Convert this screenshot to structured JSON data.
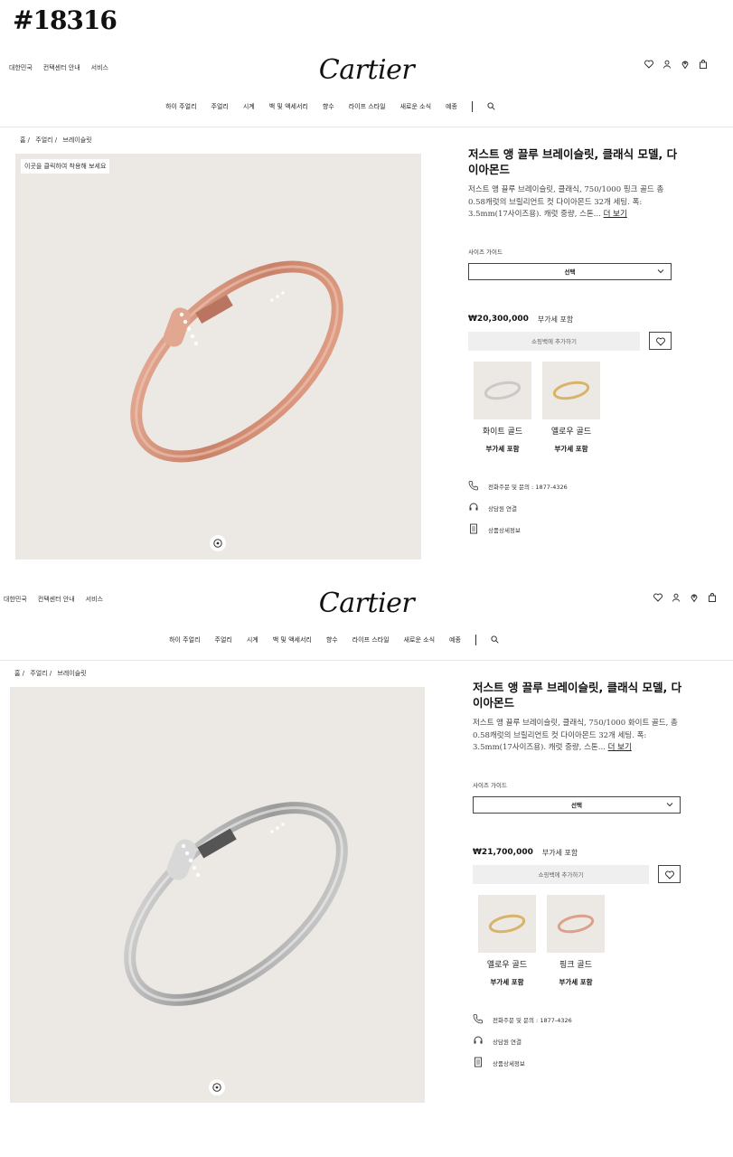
{
  "sheet_tag": "#18316",
  "header": {
    "util_links": [
      "대한민국",
      "컨택센터 안내",
      "서비스"
    ],
    "logo": "Cartier",
    "icons": [
      "heart-icon",
      "user-icon",
      "location-pin-icon",
      "shopping-bag-icon"
    ],
    "nav_items": [
      "하이 주얼리",
      "주얼리",
      "시계",
      "백 및 액세서리",
      "향수",
      "라이프 스타일",
      "새로운 소식",
      "예종"
    ]
  },
  "breadcrumb": [
    "홈 /",
    "주얼리 /",
    "브레이슬릿"
  ],
  "pages": [
    {
      "zoom_hint": "이곳을 클릭하여 착용해 보세요",
      "metal_color": "#d9a088",
      "title": "저스트 앵 끌루 브레이슬릿, 클래식 모델, 다이아몬드",
      "description": "저스트 앵 끌루 브레이슬릿, 클래식, 750/1000 핑크 골드 총 0.58캐럿의 브릴리언트 컷 다이아몬드 32개 세팅. 폭: 3.5mm(17사이즈용). 캐럿 중량, 스톤...",
      "more_link": "더 보기",
      "size_guide": "사이즈 가이드",
      "select_label": "선택",
      "price": "₩20,300,000",
      "vat_label": "부가세 포함",
      "cart_button": "쇼핑백에 추가하기",
      "variants": [
        {
          "name": "화이트 골드",
          "vat": "부가세 포함",
          "color": "#c9c9c9"
        },
        {
          "name": "옐로우 골드",
          "vat": "부가세 포함",
          "color": "#d8b36a"
        }
      ],
      "contacts": [
        "전화주문 및 문의 : 1877-4326",
        "상담원 연결",
        "상품상세정보"
      ]
    },
    {
      "zoom_hint": "",
      "metal_color": "#c4c4c4",
      "title": "저스트 앵 끌루 브레이슬릿, 클래식 모델, 다이아몬드",
      "description": "저스트 앵 끌루 브레이슬릿, 클래식, 750/1000 화이트 골드, 총 0.58캐럿의 브릴리언트 컷 다이아몬드 32개 세팅. 폭: 3.5mm(17사이즈용). 캐럿 중량, 스톤...",
      "more_link": "더 보기",
      "size_guide": "사이즈 가이드",
      "select_label": "선택",
      "price": "₩21,700,000",
      "vat_label": "부가세 포함",
      "cart_button": "쇼핑백에 추가하기",
      "variants": [
        {
          "name": "옐로우 골드",
          "vat": "부가세 포함",
          "color": "#d8b36a"
        },
        {
          "name": "핑크 골드",
          "vat": "부가세 포함",
          "color": "#dda08a"
        }
      ],
      "contacts": [
        "전화주문 및 문의 : 1877-4326",
        "상담원 연결",
        "상품상세정보"
      ]
    }
  ]
}
